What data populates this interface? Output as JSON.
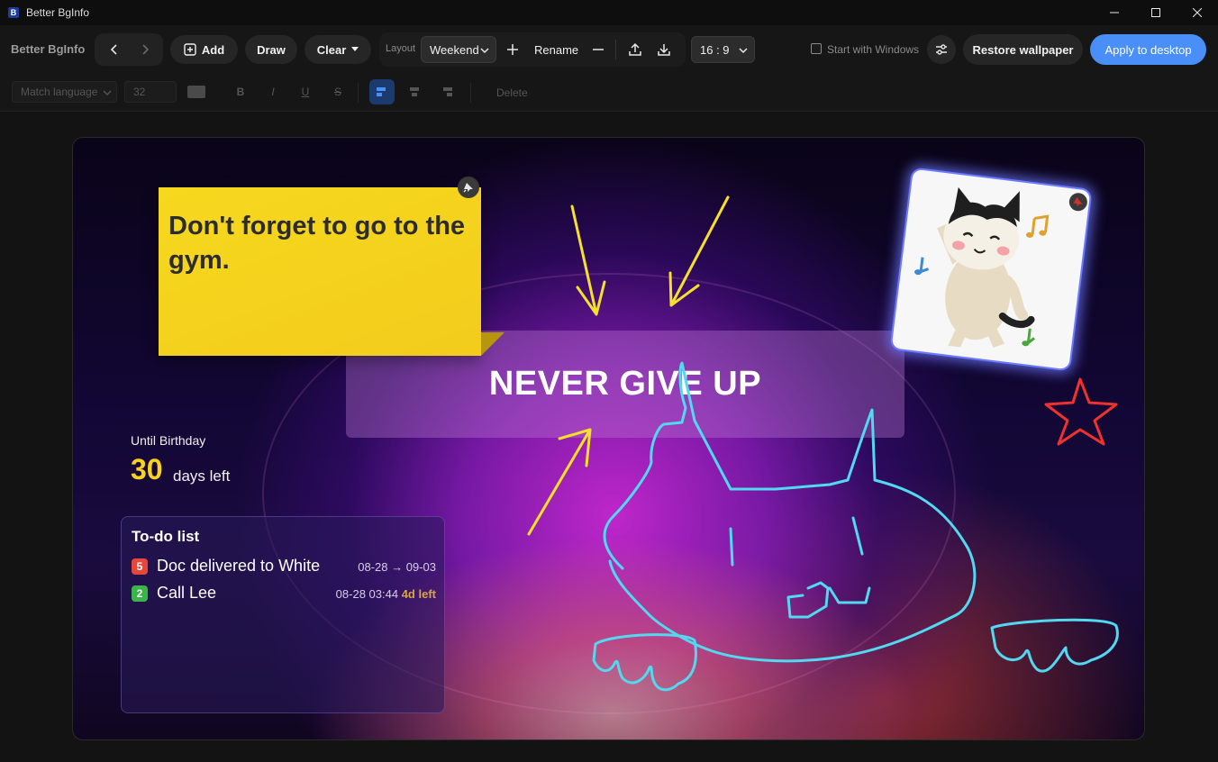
{
  "window": {
    "title": "Better BgInfo",
    "icon_letter": "B"
  },
  "toolbar": {
    "brand": "Better BgInfo",
    "add_label": "Add",
    "draw_label": "Draw",
    "clear_label": "Clear",
    "layout_label": "Layout",
    "layout_value": "Weekend",
    "rename_label": "Rename",
    "ratio_value": "16 : 9",
    "start_with_windows_label": "Start with Windows",
    "start_with_windows_checked": false,
    "restore_label": "Restore wallpaper",
    "apply_label": "Apply to desktop"
  },
  "format_bar": {
    "language_value": "Match language",
    "font_size_value": "32",
    "bold_label": "B",
    "italic_label": "I",
    "underline_label": "U",
    "strike_label": "S",
    "delete_label": "Delete"
  },
  "canvas": {
    "sticky_note": "Don't forget to go to the gym.",
    "banner": "NEVER GIVE UP",
    "birthday": {
      "label": "Until Birthday",
      "days": "30",
      "suffix": "days left"
    },
    "todo": {
      "title": "To-do list",
      "items": [
        {
          "badge": "5",
          "badge_color": "#e5473b",
          "text": "Doc delivered to White",
          "date": "08-28 → 09-03",
          "remaining": ""
        },
        {
          "badge": "2",
          "badge_color": "#39b54a",
          "text": "Call Lee",
          "date": "08-28 03:44",
          "remaining": "4d left"
        }
      ]
    }
  },
  "colors": {
    "accent": "#4a8ff7",
    "sticky": "#f5d31d",
    "drawing_yellow": "#f5e12a",
    "drawing_cyan": "#52d8f0",
    "drawing_red": "#f0322f"
  }
}
